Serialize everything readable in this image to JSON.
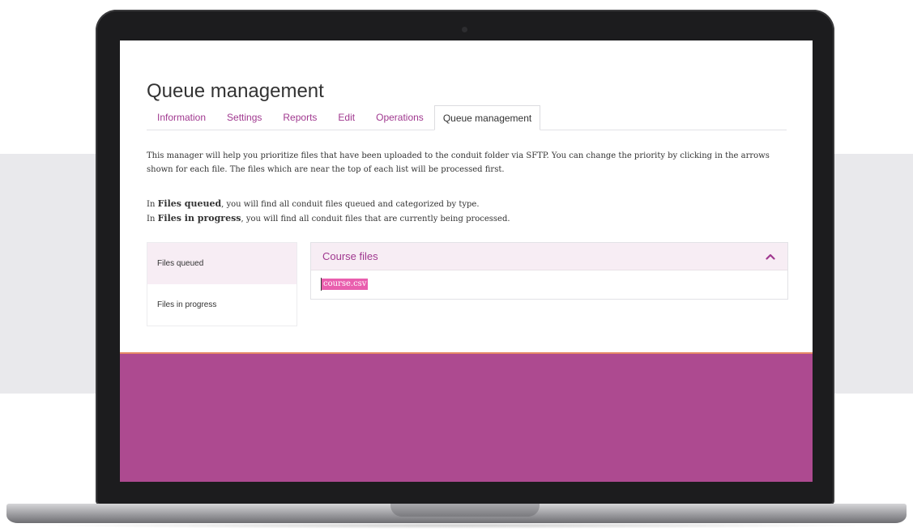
{
  "page": {
    "title": "Queue management"
  },
  "tabs": [
    {
      "label": "Information",
      "active": false
    },
    {
      "label": "Settings",
      "active": false
    },
    {
      "label": "Reports",
      "active": false
    },
    {
      "label": "Edit",
      "active": false
    },
    {
      "label": "Operations",
      "active": false
    },
    {
      "label": "Queue management",
      "active": true
    }
  ],
  "intro": {
    "text": "This manager will help you prioritize files that have been uploaded to the conduit folder via SFTP. You can change the priority by clicking in the arrows shown for each file. The files which are near the top of each list will be processed first."
  },
  "desc": {
    "line1_prefix": "In ",
    "line1_bold": "Files queued",
    "line1_rest": ", you will find all conduit files queued and categorized by type.",
    "line2_prefix": "In ",
    "line2_bold": "Files in progress",
    "line2_rest": ", you will find all conduit files that are currently being processed."
  },
  "sidebar": {
    "items": [
      {
        "label": "Files queued",
        "active": true
      },
      {
        "label": "Files in progress",
        "active": false
      }
    ]
  },
  "accordion": {
    "title": "Course files",
    "expanded": true,
    "files": [
      "course.csv"
    ]
  },
  "colors": {
    "accent": "#a0388f",
    "footer": "#ad4a90",
    "highlight": "#e95fae",
    "footer_border": "#e58a66",
    "panel_bg": "#f7edf4"
  }
}
